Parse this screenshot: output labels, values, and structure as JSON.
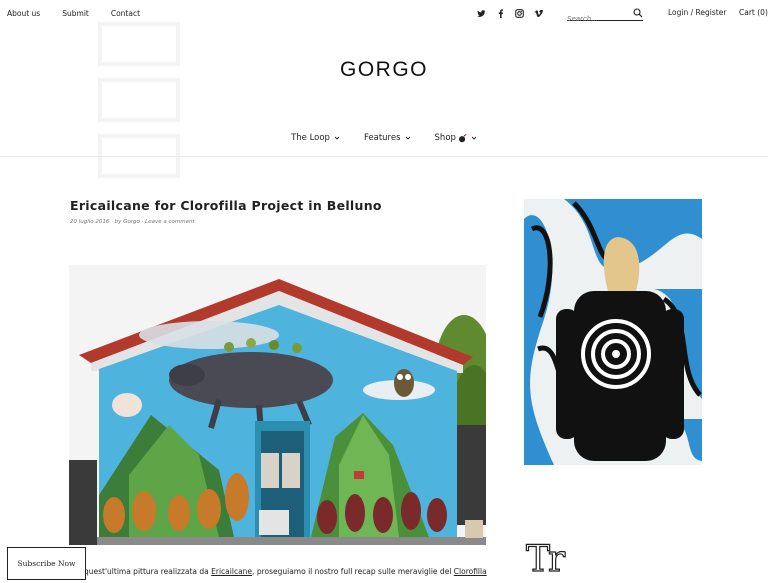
{
  "topnav": {
    "about": "About us",
    "submit": "Submit",
    "contact": "Contact"
  },
  "social": {
    "icons": [
      "twitter-icon",
      "facebook-icon",
      "instagram-icon",
      "vimeo-icon"
    ]
  },
  "search": {
    "placeholder": "Search..."
  },
  "account": {
    "login": "Login / Register",
    "cart": "Cart (0)"
  },
  "site": {
    "logo": "GORGO"
  },
  "mainnav": {
    "loop": "The Loop",
    "features": "Features",
    "shop": "Shop"
  },
  "post": {
    "title": "Ericailcane for Clorofilla Project in Belluno",
    "date": "20 luglio 2016",
    "by_prefix": "· by",
    "author": "Gorgo",
    "comment": "· Leave a comment",
    "excerpt_start": "quest'ultima pittura realizzata da ",
    "excerpt_link1": "Ericailcane",
    "excerpt_mid": ", proseguiamo il nostro full recap sulle meraviglie del ",
    "excerpt_link2": "Clorofilla"
  },
  "sidebar": {
    "brand_mark": "Tr"
  },
  "subscribe": {
    "label": "Subscribe Now"
  },
  "colors": {
    "text": "#222222",
    "divider": "#e9e9e9",
    "mural_blue": "#4fb4dd",
    "roof_red": "#b23a2c",
    "ad_blue": "#2f8fd0"
  }
}
